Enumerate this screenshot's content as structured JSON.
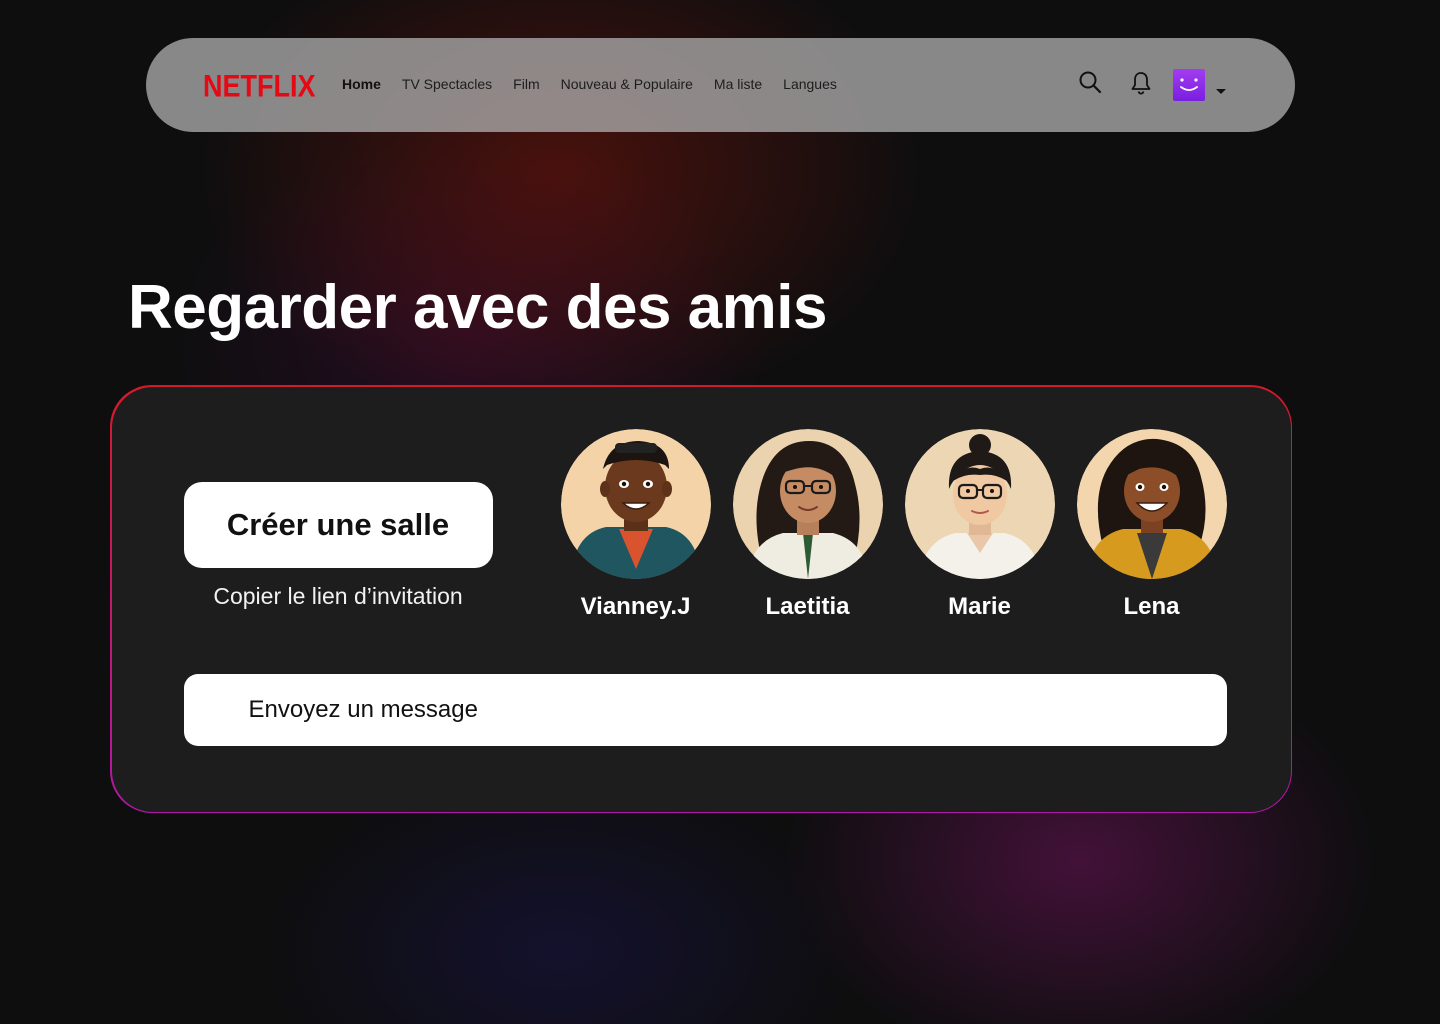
{
  "brand": {
    "logo_text": "NETFLIX",
    "accent": "#e50914"
  },
  "nav": {
    "links": [
      {
        "label": "Home",
        "active": true
      },
      {
        "label": "TV Spectacles",
        "active": false
      },
      {
        "label": "Film",
        "active": false
      },
      {
        "label": "Nouveau & Populaire",
        "active": false
      },
      {
        "label": "Ma liste",
        "active": false
      },
      {
        "label": "Langues",
        "active": false
      }
    ],
    "icons": [
      "search-icon",
      "bell-icon",
      "profile-avatar",
      "caret-down-icon"
    ]
  },
  "page": {
    "title": "Regarder avec des amis"
  },
  "room": {
    "create_label": "Créer une salle",
    "copy_link_label": "Copier le lien d’invitation",
    "message_placeholder": "Envoyez un message"
  },
  "friends": [
    {
      "name": "Vianney.J"
    },
    {
      "name": "Laetitia"
    },
    {
      "name": "Marie"
    },
    {
      "name": "Lena"
    }
  ]
}
